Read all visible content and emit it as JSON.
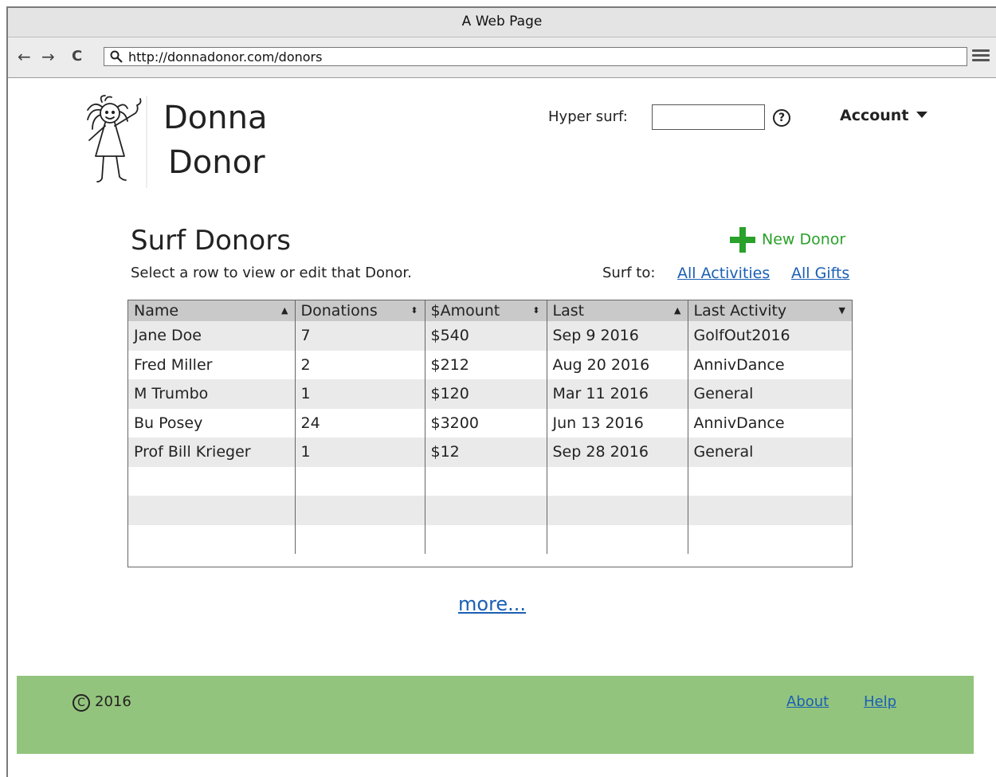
{
  "window": {
    "title": "A Web Page"
  },
  "browser": {
    "url": "http://donnadonor.com/donors",
    "back_icon": "←",
    "forward_icon": "→",
    "refresh_icon": "C"
  },
  "header": {
    "brand_line1": "Donna",
    "brand_line2": "Donor",
    "hyper_surf_label": "Hyper surf:",
    "help_label": "?",
    "account_label": "Account"
  },
  "main": {
    "title": "Surf Donors",
    "subtitle": "Select a row to view or edit that Donor.",
    "new_donor_label": "New Donor",
    "surf_to_label": "Surf to:",
    "surf_links": [
      "All Activities",
      "All Gifts"
    ],
    "more_label": "more..."
  },
  "table": {
    "columns": [
      {
        "label": "Name",
        "sort": "▲"
      },
      {
        "label": "Donations",
        "sort": "⬍"
      },
      {
        "label": "$Amount",
        "sort": "⬍"
      },
      {
        "label": "Last",
        "sort": "▲"
      },
      {
        "label": "Last Activity",
        "sort": "▼"
      }
    ],
    "rows": [
      [
        "Jane Doe",
        "7",
        "$540",
        "Sep 9 2016",
        "GolfOut2016"
      ],
      [
        "Fred Miller",
        "2",
        "$212",
        "Aug 20 2016",
        "AnnivDance"
      ],
      [
        "M Trumbo",
        "1",
        "$120",
        "Mar 11 2016",
        "General"
      ],
      [
        "Bu Posey",
        "24",
        "$3200",
        "Jun 13 2016",
        "AnnivDance"
      ],
      [
        "Prof Bill Krieger",
        "1",
        "$12",
        "Sep 28 2016",
        "General"
      ],
      [
        "",
        "",
        "",
        "",
        ""
      ],
      [
        "",
        "",
        "",
        "",
        ""
      ],
      [
        "",
        "",
        "",
        "",
        ""
      ]
    ]
  },
  "footer": {
    "copyright_symbol": "C",
    "year": "2016",
    "links": [
      "About",
      "Help"
    ]
  },
  "colors": {
    "footer_bg": "#93c47d",
    "link": "#1a5fb4",
    "accent_green": "#2aa12a"
  }
}
